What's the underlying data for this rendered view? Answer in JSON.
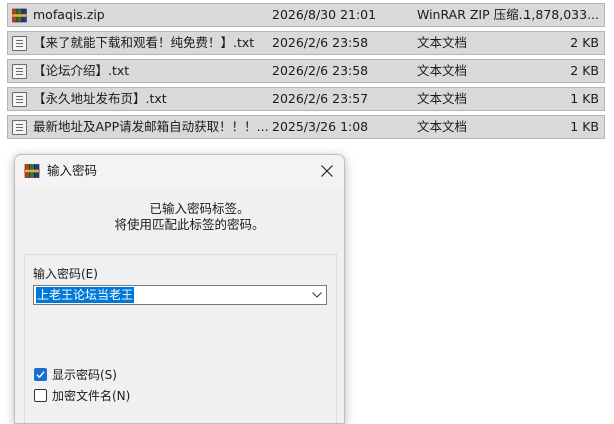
{
  "files": [
    {
      "icon": "winrar-archive-icon",
      "name": "mofaqis.zip",
      "date": "2026/8/30 21:01",
      "type": "WinRAR ZIP 压缩...",
      "size": "1,878,033..."
    },
    {
      "icon": "text-file-icon",
      "name": "【来了就能下载和观看！纯免费！】.txt",
      "date": "2026/2/6 23:58",
      "type": "文本文档",
      "size": "2 KB"
    },
    {
      "icon": "text-file-icon",
      "name": "【论坛介绍】.txt",
      "date": "2026/2/6 23:58",
      "type": "文本文档",
      "size": "2 KB"
    },
    {
      "icon": "text-file-icon",
      "name": "【永久地址发布页】.txt",
      "date": "2026/2/6 23:57",
      "type": "文本文档",
      "size": "1 KB"
    },
    {
      "icon": "text-file-icon",
      "name": "最新地址及APP请发邮箱自动获取！！！....",
      "date": "2025/3/26 1:08",
      "type": "文本文档",
      "size": "1 KB"
    }
  ],
  "dialog": {
    "title": "输入密码",
    "title_icon": "winrar-icon",
    "close_icon": "close-icon",
    "description_line1": "已输入密码标签。",
    "description_line2": "将使用匹配此标签的密码。",
    "password_label": "输入密码(E)",
    "password_value": "上老王论坛当老王",
    "dropdown_icon": "chevron-down-icon",
    "show_password_label": "显示密码(S)",
    "show_password_checked": true,
    "encrypt_filenames_label": "加密文件名(N)",
    "encrypt_filenames_checked": false
  },
  "colors": {
    "selection": "#0078d7",
    "checkbox_accent": "#1c6fd1",
    "row_highlight": "#d9d9d9"
  }
}
